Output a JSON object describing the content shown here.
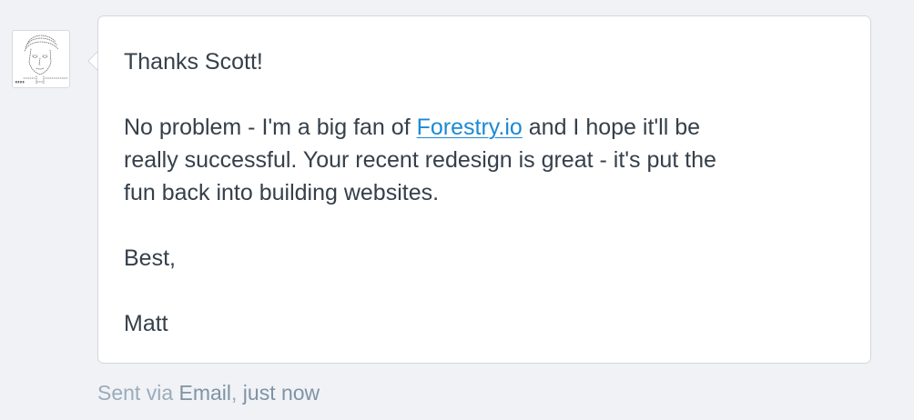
{
  "conversation": {
    "avatar": {
      "icon": "ascii-portrait-icon",
      "caption": "MATT"
    },
    "message": {
      "greeting": "Thanks Scott!",
      "body": {
        "line1_before_link": "No problem - I'm a big fan of ",
        "link_text": "Forestry.io",
        "line1_after_link": " and I hope it'll be",
        "line2": "really successful. Your recent redesign is great - it's put the",
        "line3": "fun back into building websites."
      },
      "signoff": "Best,",
      "signature": "Matt"
    },
    "meta": {
      "prefix": "Sent via ",
      "channel": "Email",
      "separator": ",",
      "time": " just now"
    }
  },
  "colors": {
    "background": "#f0f2f5",
    "bubble": "#ffffff",
    "text": "#36404a",
    "link": "#1c8ad1",
    "meta_muted": "#9aabbb",
    "meta_emphasis": "#7f93a6"
  }
}
